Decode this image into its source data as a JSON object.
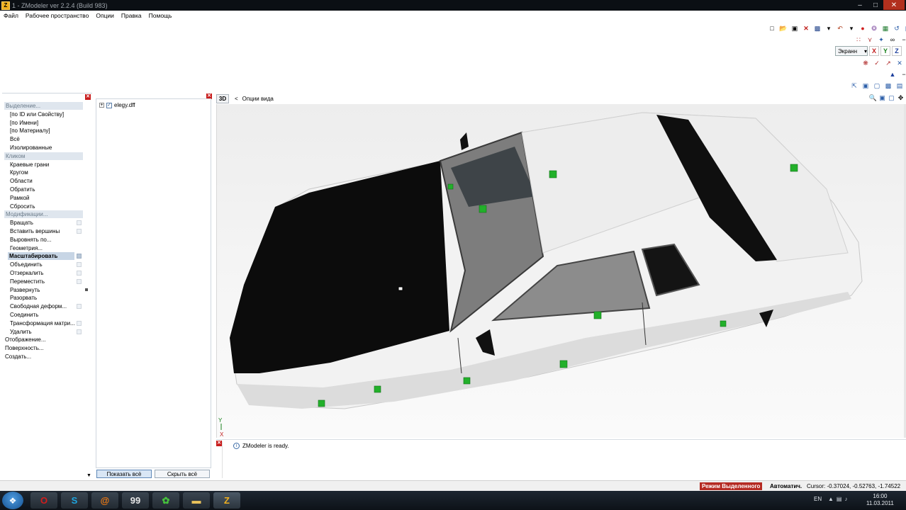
{
  "window": {
    "title": "1 - ZModeler ver 2.2.4 (Build 983)"
  },
  "menu": [
    {
      "label": "Файл",
      "name": "menu-file"
    },
    {
      "label": "Рабочее пространство",
      "name": "menu-workspace"
    },
    {
      "label": "Опции",
      "name": "menu-options"
    },
    {
      "label": "Правка",
      "name": "menu-edit"
    },
    {
      "label": "Помощь",
      "name": "menu-help"
    }
  ],
  "toolbar": {
    "view_dropdown": "Экранн",
    "axes": [
      "X",
      "Y",
      "Z"
    ]
  },
  "command_panel": {
    "rows": [
      {
        "label": "Выделение...",
        "type": "section"
      },
      {
        "label": "[по ID или Свойству]",
        "type": "item"
      },
      {
        "label": "[по Имени]",
        "type": "item"
      },
      {
        "label": "[по Материалу]",
        "type": "item"
      },
      {
        "label": "Всё",
        "type": "item"
      },
      {
        "label": "Изолированные",
        "type": "item"
      },
      {
        "label": "Кликом",
        "type": "section"
      },
      {
        "label": "Краевые грани",
        "type": "item"
      },
      {
        "label": "Кругом",
        "type": "item"
      },
      {
        "label": "Области",
        "type": "item"
      },
      {
        "label": "Обратить",
        "type": "item"
      },
      {
        "label": "Рамкой",
        "type": "item"
      },
      {
        "label": "Сбросить",
        "type": "item"
      },
      {
        "label": "Модификации...",
        "type": "section"
      },
      {
        "label": "Вращать",
        "type": "item",
        "box": true
      },
      {
        "label": "Вставить вершины",
        "type": "item",
        "box": true
      },
      {
        "label": "Выровнять по...",
        "type": "item"
      },
      {
        "label": "Геометрия...",
        "type": "item"
      },
      {
        "label": "Масштабировать",
        "type": "selected",
        "box": true
      },
      {
        "label": "Объединить",
        "type": "item",
        "box": true
      },
      {
        "label": "Отзеркалить",
        "type": "item",
        "box": true
      },
      {
        "label": "Переместить",
        "type": "item",
        "box": true
      },
      {
        "label": "Развернуть",
        "type": "item",
        "mark": true
      },
      {
        "label": "Разорвать",
        "type": "item"
      },
      {
        "label": "Свободная деформ...",
        "type": "item",
        "box": true
      },
      {
        "label": "Соединить",
        "type": "item"
      },
      {
        "label": "Трансформация матри...",
        "type": "item",
        "box": true
      },
      {
        "label": "Удалить",
        "type": "item",
        "box": true
      },
      {
        "label": "Отображение...",
        "type": "top"
      },
      {
        "label": "Поверхность...",
        "type": "top"
      },
      {
        "label": "Создать...",
        "type": "top"
      }
    ]
  },
  "tree": {
    "item": "elegy.dff",
    "show_all": "Показать всё",
    "hide_all": "Скрыть всё"
  },
  "viewport": {
    "mode": "3D",
    "options_label": "Опции вида",
    "axis_y": "Y",
    "axis_x": "X"
  },
  "log": {
    "message": "ZModeler is ready."
  },
  "status": {
    "mode": "Режим Выделенного",
    "auto": "Автоматич.",
    "cursor": "Cursor: -0.37024, -0.52763, -1.74522"
  },
  "taskbar": {
    "lang": "EN",
    "time": "16:00",
    "date": "11.03.2011",
    "apps": [
      {
        "name": "opera-icon",
        "glyph": "O",
        "color": "#d21d1d"
      },
      {
        "name": "skype-icon",
        "glyph": "S",
        "color": "#1ea5e0"
      },
      {
        "name": "mail-agent-icon",
        "glyph": "@",
        "color": "#f07a12"
      },
      {
        "name": "notepad-icon",
        "glyph": "99",
        "color": "#e7e7e7"
      },
      {
        "name": "icq-icon",
        "glyph": "✿",
        "color": "#46c23c"
      },
      {
        "name": "folder-icon",
        "glyph": "▬",
        "color": "#e8c15a"
      },
      {
        "name": "zmodeler-icon",
        "glyph": "Z",
        "color": "#f0b020"
      }
    ]
  }
}
